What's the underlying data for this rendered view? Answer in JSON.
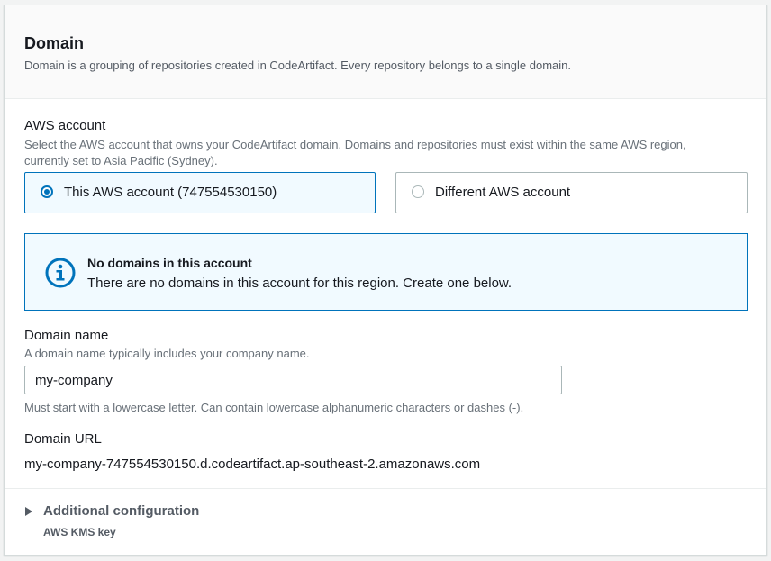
{
  "header": {
    "title": "Domain",
    "description": "Domain is a grouping of repositories created in CodeArtifact. Every repository belongs to a single domain."
  },
  "aws_account": {
    "label": "AWS account",
    "description_line1": "Select the AWS account that owns your CodeArtifact domain. Domains and repositories must exist within the same AWS region,",
    "description_line2": "currently set to Asia Pacific (Sydney).",
    "options": [
      {
        "label": "This AWS account (747554530150)",
        "selected": true
      },
      {
        "label": "Different AWS account",
        "selected": false
      }
    ]
  },
  "info_alert": {
    "icon": "info-icon",
    "title": "No domains in this account",
    "text": "There are no domains in this account for this region. Create one below."
  },
  "domain_name": {
    "label": "Domain name",
    "description": "A domain name typically includes your company name.",
    "value": "my-company",
    "constraint": "Must start with a lowercase letter. Can contain lowercase alphanumeric characters or dashes (-)."
  },
  "domain_url": {
    "label": "Domain URL",
    "value": "my-company-747554530150.d.codeartifact.ap-southeast-2.amazonaws.com"
  },
  "additional_configuration": {
    "label": "Additional configuration",
    "subtitle": "AWS KMS key",
    "expanded": false
  },
  "colors": {
    "accent": "#0073bb",
    "selected_bg": "#f1faff",
    "text": "#16191f",
    "secondary_text": "#687078"
  }
}
